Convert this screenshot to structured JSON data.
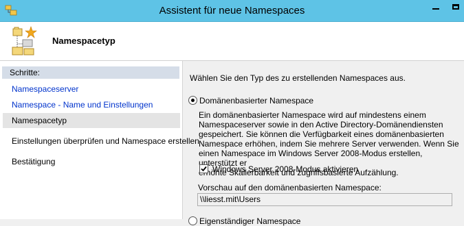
{
  "window": {
    "title": "Assistent für neue Namespaces",
    "icons": {
      "app": "wizard-app-icon",
      "minimize": "minimize-icon",
      "maximize": "maximize-icon"
    }
  },
  "header": {
    "title": "Namespacetyp",
    "icon": "namespace-tree-icon"
  },
  "sidebar": {
    "heading": "Schritte:",
    "steps": [
      {
        "label": "Namespaceserver",
        "state": "link"
      },
      {
        "label": "Namespace - Name und Einstellungen",
        "state": "link"
      },
      {
        "label": "Namespacetyp",
        "state": "current"
      },
      {
        "label": "Einstellungen überprüfen und Namespace erstellen",
        "state": "pending"
      },
      {
        "label": "Bestätigung",
        "state": "pending"
      }
    ]
  },
  "main": {
    "intro": "Wählen Sie den Typ des zu erstellenden Namespaces aus.",
    "option_domain": {
      "label": "Domänenbasierter Namespace",
      "selected": true,
      "description_lines": [
        "Ein domänenbasierter Namespace wird auf mindestens einem",
        "Namespaceserver sowie in den Active Directory-Domänendiensten",
        "gespeichert. Sie können die Verfügbarkeit eines domänenbasierten",
        "Namespace erhöhen, indem Sie mehrere Server verwenden. Wenn Sie",
        "einen Namespace im Windows Server 2008-Modus erstellen, unterstützt er",
        "erhöhte Skalierbarkeit und zugriffsbasierte Aufzählung."
      ],
      "checkbox_label": "Windows Server 2008-Modus aktivieren",
      "checkbox_checked": true,
      "preview_label": "Vorschau auf den domänenbasierten Namespace:",
      "preview_value": "\\\\liesst.mit\\Users"
    },
    "option_standalone": {
      "label": "Eigenständiger Namespace",
      "selected": false
    }
  },
  "colors": {
    "titlebar": "#5ec3e6",
    "link": "#0033cc",
    "steps_heading_bg": "#d5dde8",
    "current_step_bg": "#e4e4e4"
  }
}
